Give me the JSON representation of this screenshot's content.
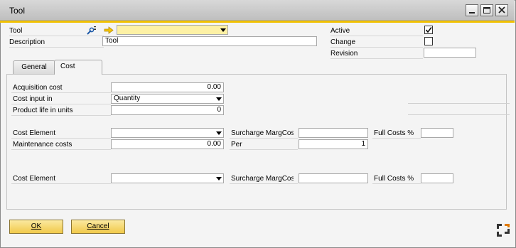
{
  "window": {
    "title": "Tool",
    "accent_color": "#f0c000"
  },
  "header": {
    "tool_label": "Tool",
    "tool_value": "",
    "description_label": "Description",
    "description_value": "Tool",
    "active_label": "Active",
    "active_checked": true,
    "change_label": "Change",
    "change_checked": false,
    "revision_label": "Revision",
    "revision_value": ""
  },
  "tabs": [
    {
      "label": "General",
      "selected": false
    },
    {
      "label": "Cost",
      "selected": true
    }
  ],
  "cost": {
    "acquisition_cost_label": "Acquisition cost",
    "acquisition_cost_value": "0.00",
    "cost_input_in_label": "Cost input in",
    "cost_input_in_value": "Quantity",
    "product_life_label": "Product life in units",
    "product_life_value": "0",
    "cost_element_label": "Cost Element",
    "cost_element_value": "",
    "surcharge_label": "Surcharge MargCos",
    "surcharge_value": "",
    "full_costs_label": "Full Costs %",
    "full_costs_value": "",
    "maintenance_label": "Maintenance costs",
    "maintenance_value": "0.00",
    "per_label": "Per",
    "per_value": "1",
    "cost_element2_label": "Cost Element",
    "cost_element2_value": "",
    "surcharge2_label": "Surcharge MargCos",
    "surcharge2_value": "",
    "full_costs2_label": "Full Costs %",
    "full_costs2_value": ""
  },
  "buttons": {
    "ok_label": "OK",
    "cancel_label": "Cancel"
  }
}
